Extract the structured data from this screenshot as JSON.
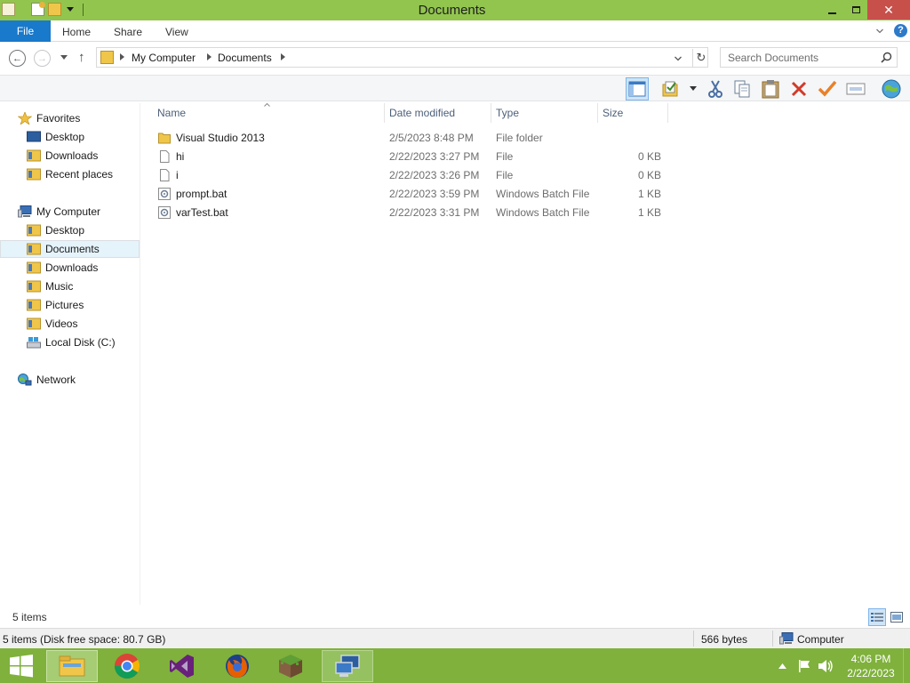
{
  "window": {
    "title": "Documents"
  },
  "ribbon": {
    "file_tab": "File",
    "tabs": [
      "Home",
      "Share",
      "View"
    ],
    "help": "?"
  },
  "address": {
    "crumbs": [
      "My Computer",
      "Documents"
    ],
    "search_placeholder": "Search Documents"
  },
  "nav": {
    "favorites": {
      "label": "Favorites",
      "items": [
        "Desktop",
        "Downloads",
        "Recent places"
      ]
    },
    "computer": {
      "label": "My Computer",
      "items": [
        "Desktop",
        "Documents",
        "Downloads",
        "Music",
        "Pictures",
        "Videos",
        "Local Disk (C:)"
      ]
    },
    "network": {
      "label": "Network"
    }
  },
  "filelist": {
    "columns": [
      "Name",
      "Date modified",
      "Type",
      "Size"
    ],
    "files": [
      {
        "name": "Visual Studio 2013",
        "date": "2/5/2023 8:48 PM",
        "type": "File folder",
        "size": "",
        "icon": "folder-icon"
      },
      {
        "name": "hi",
        "date": "2/22/2023 3:27 PM",
        "type": "File",
        "size": "0 KB",
        "icon": "file-icon"
      },
      {
        "name": "i",
        "date": "2/22/2023 3:26 PM",
        "type": "File",
        "size": "0 KB",
        "icon": "file-icon"
      },
      {
        "name": "prompt.bat",
        "date": "2/22/2023 3:59 PM",
        "type": "Windows Batch File",
        "size": "1 KB",
        "icon": "batch-file-icon"
      },
      {
        "name": "varTest.bat",
        "date": "2/22/2023 3:31 PM",
        "type": "Windows Batch File",
        "size": "1 KB",
        "icon": "batch-file-icon"
      }
    ]
  },
  "status": {
    "items_count": "5 items"
  },
  "details": {
    "summary": "5 items (Disk free space: 80.7 GB)",
    "bytes": "566 bytes",
    "location": "Computer"
  },
  "taskbar": {
    "apps": [
      "file-explorer-icon",
      "chrome-icon",
      "visual-studio-icon",
      "firefox-icon",
      "minecraft-icon",
      "remote-desktop-icon"
    ],
    "time": "4:06 PM",
    "date": "2/22/2023"
  },
  "colors": {
    "title_bar": "#92c54e",
    "file_tab": "#1979ca",
    "taskbar": "#7fb13c",
    "close_button": "#c7504b",
    "selection": "#e5f3fb"
  }
}
